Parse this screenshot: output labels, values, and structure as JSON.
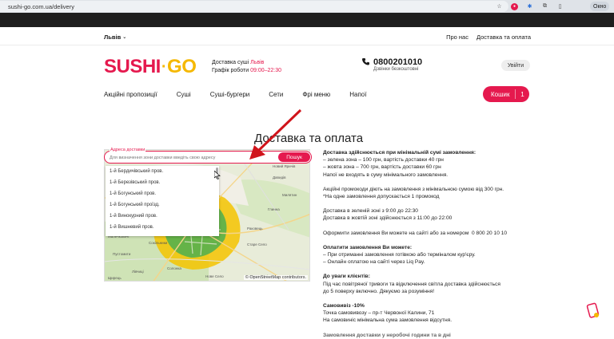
{
  "browser": {
    "url": "sushi-go.com.ua/delivery",
    "profile_label": "Окно"
  },
  "header": {
    "city": "Львів",
    "top_links": [
      "Про нас",
      "Доставка та оплата"
    ],
    "delivery_prefix": "Доставка суші",
    "delivery_city": "Львів",
    "schedule_prefix": "Графік роботи",
    "schedule_hours": "09:00–22:30",
    "phone": "0800201010",
    "phone_note": "Дзвінки безкоштовні",
    "login_label": "Увійти",
    "logo_left": "SUSHI",
    "logo_dot": "·",
    "logo_right": "GO"
  },
  "nav": {
    "items": [
      "Акційні пропозиції",
      "Суші",
      "Суші-бургери",
      "Сети",
      "Фрі меню",
      "Напої"
    ],
    "cart_label": "Кошик",
    "cart_count": "1"
  },
  "page": {
    "title": "Доставка та оплата"
  },
  "address": {
    "label": "Адреса доставки",
    "placeholder": "Для визначення зони доставки введіть свою адресу",
    "search_label": "Пошук",
    "suggestions": [
      "1-й Бердичівський пров.",
      "1-й Березівський пров.",
      "1-й Богунський пров.",
      "1-й Богунський проїзд.",
      "1-й Винокурний пров.",
      "1-й Вишневий пров."
    ]
  },
  "map": {
    "attribution": "© OpenStreetMap contributors.",
    "labels": [
      "Зубра",
      "Давидів",
      "Пустомити",
      "Сокільники",
      "Солонка",
      "Лівчиці",
      "Дмитровичі",
      "Малечковичі",
      "Рудне",
      "Щирець",
      "Нове Село",
      "Милятин",
      "Глинна",
      "Новий Яричів",
      "Старе Село",
      "Раковець"
    ],
    "zone_colors": {
      "green": "#4caf50",
      "yellow": "#f5c400"
    }
  },
  "info": {
    "s1_title": "Доставка здійснюється при мінімальній сумі замовлення:",
    "s1_l1": "– зелена зона – 100 грн, вартість доставки 40 грн",
    "s1_l2": "– жовта зона – 700 грн, вартість доставки 60 грн",
    "s1_l3": "Напої не входять в суму мінімального замовлення.",
    "s2_l1": "Акційні промокоди діють на замовлення з мінімальною сумою від 300 грн.",
    "s2_l2": "*На одне замовлення допускається 1 промокод",
    "s3_l1": "Доставка в зеленій зоні з 9:00 до 22:30",
    "s3_l2": "Доставка в жовтій зоні здійснюється з 11:00 до 22:00",
    "s4_l1": "Оформити замовлення Ви можете на сайті або за номером",
    "s4_phone": "0 800 20 10 10",
    "s5_title": "Оплатити замовлення Ви можете:",
    "s5_l1": "– При отриманні замовлення готівкою або терміналом кур'єру.",
    "s5_l2": "– Онлайн оплатою на сайті через Liq Pay.",
    "s6_title": "До уваги клієнтів:",
    "s6_l1": "Під час повітряної тривоги та відключення світла доставка здійснюється",
    "s6_l2": "до 5 поверху включно. Дякуємо за розуміння!",
    "s7_title": "Самовивіз -10%",
    "s7_l1": "Точка самовивозу – пр-т Червоної Калини, 71",
    "s7_l2": "На самовиніс мінімальна сума замовлення відсутня.",
    "s8_partial": "Замовлення доставки у неробочі години та в дні"
  },
  "colors": {
    "brand_red": "#e5194e",
    "brand_yellow": "#f5b800"
  }
}
